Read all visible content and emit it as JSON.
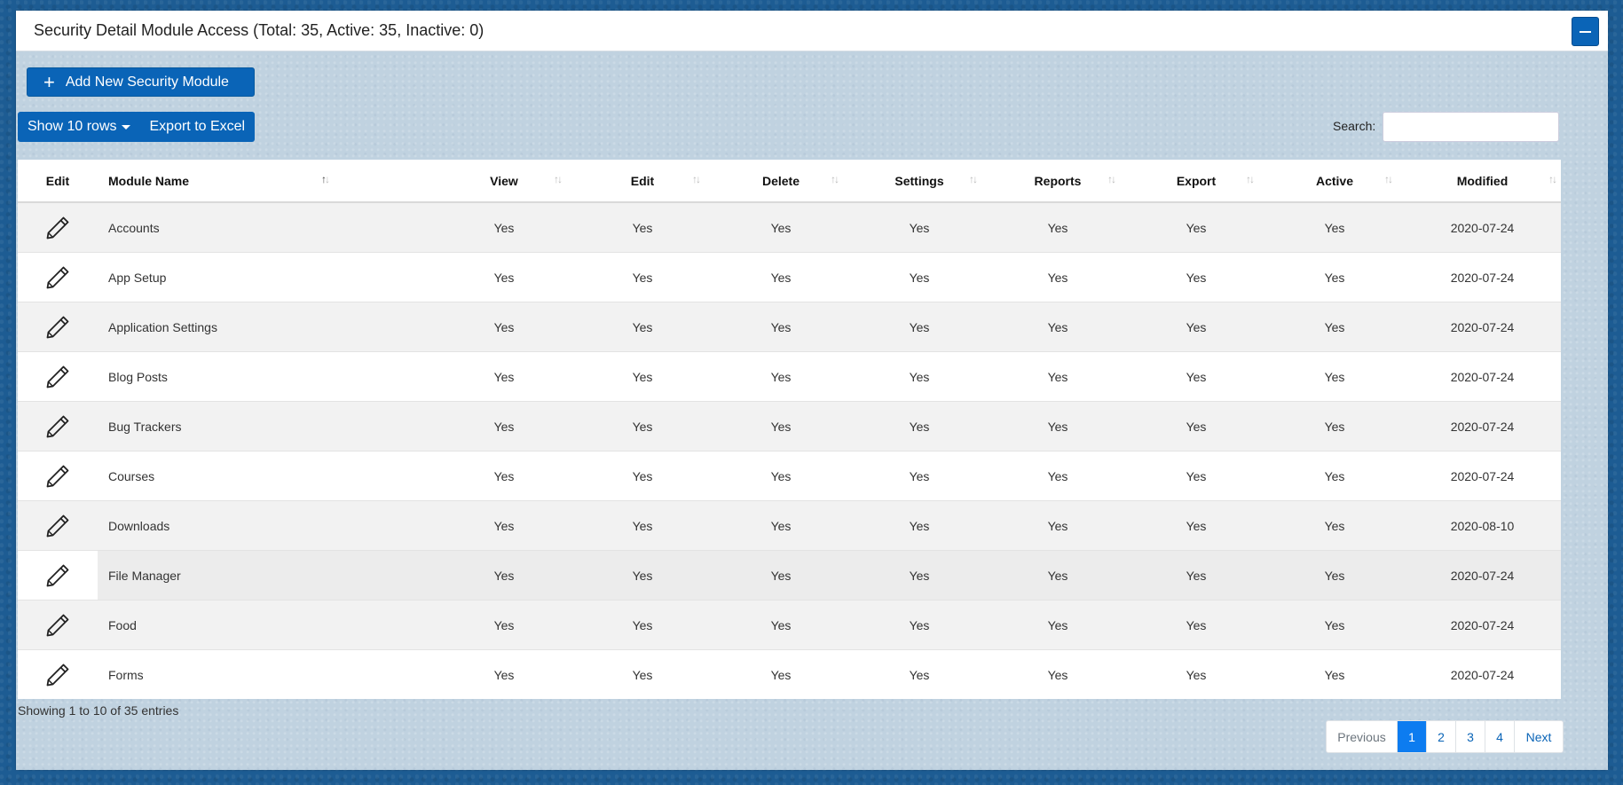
{
  "panel": {
    "title": "Security Detail Module Access (Total: 35, Active: 35, Inactive: 0)",
    "collapse_icon": "minus-icon"
  },
  "toolbar": {
    "add_label": "Add New Security Module",
    "show_rows_label": "Show 10 rows",
    "export_label": "Export to Excel",
    "search_label": "Search:",
    "search_value": ""
  },
  "table": {
    "headers": [
      "Edit",
      "Module Name",
      "View",
      "Edit",
      "Delete",
      "Settings",
      "Reports",
      "Export",
      "Active",
      "Modified"
    ],
    "rows": [
      {
        "name": "Accounts",
        "view": "Yes",
        "edit": "Yes",
        "delete": "Yes",
        "settings": "Yes",
        "reports": "Yes",
        "export": "Yes",
        "active": "Yes",
        "modified": "2020-07-24"
      },
      {
        "name": "App Setup",
        "view": "Yes",
        "edit": "Yes",
        "delete": "Yes",
        "settings": "Yes",
        "reports": "Yes",
        "export": "Yes",
        "active": "Yes",
        "modified": "2020-07-24"
      },
      {
        "name": "Application Settings",
        "view": "Yes",
        "edit": "Yes",
        "delete": "Yes",
        "settings": "Yes",
        "reports": "Yes",
        "export": "Yes",
        "active": "Yes",
        "modified": "2020-07-24"
      },
      {
        "name": "Blog Posts",
        "view": "Yes",
        "edit": "Yes",
        "delete": "Yes",
        "settings": "Yes",
        "reports": "Yes",
        "export": "Yes",
        "active": "Yes",
        "modified": "2020-07-24"
      },
      {
        "name": "Bug Trackers",
        "view": "Yes",
        "edit": "Yes",
        "delete": "Yes",
        "settings": "Yes",
        "reports": "Yes",
        "export": "Yes",
        "active": "Yes",
        "modified": "2020-07-24"
      },
      {
        "name": "Courses",
        "view": "Yes",
        "edit": "Yes",
        "delete": "Yes",
        "settings": "Yes",
        "reports": "Yes",
        "export": "Yes",
        "active": "Yes",
        "modified": "2020-07-24"
      },
      {
        "name": "Downloads",
        "view": "Yes",
        "edit": "Yes",
        "delete": "Yes",
        "settings": "Yes",
        "reports": "Yes",
        "export": "Yes",
        "active": "Yes",
        "modified": "2020-08-10"
      },
      {
        "name": "File Manager",
        "view": "Yes",
        "edit": "Yes",
        "delete": "Yes",
        "settings": "Yes",
        "reports": "Yes",
        "export": "Yes",
        "active": "Yes",
        "modified": "2020-07-24"
      },
      {
        "name": "Food",
        "view": "Yes",
        "edit": "Yes",
        "delete": "Yes",
        "settings": "Yes",
        "reports": "Yes",
        "export": "Yes",
        "active": "Yes",
        "modified": "2020-07-24"
      },
      {
        "name": "Forms",
        "view": "Yes",
        "edit": "Yes",
        "delete": "Yes",
        "settings": "Yes",
        "reports": "Yes",
        "export": "Yes",
        "active": "Yes",
        "modified": "2020-07-24"
      }
    ]
  },
  "footer": {
    "info": "Showing 1 to 10 of 35 entries",
    "prev_label": "Previous",
    "pages": [
      "1",
      "2",
      "3",
      "4"
    ],
    "next_label": "Next",
    "active_page": "1"
  },
  "colors": {
    "primary": "#0a64b7",
    "page_bg": "#1d5c93",
    "panel_bg": "#c0d2e0",
    "active_page": "#0d7cf0"
  }
}
